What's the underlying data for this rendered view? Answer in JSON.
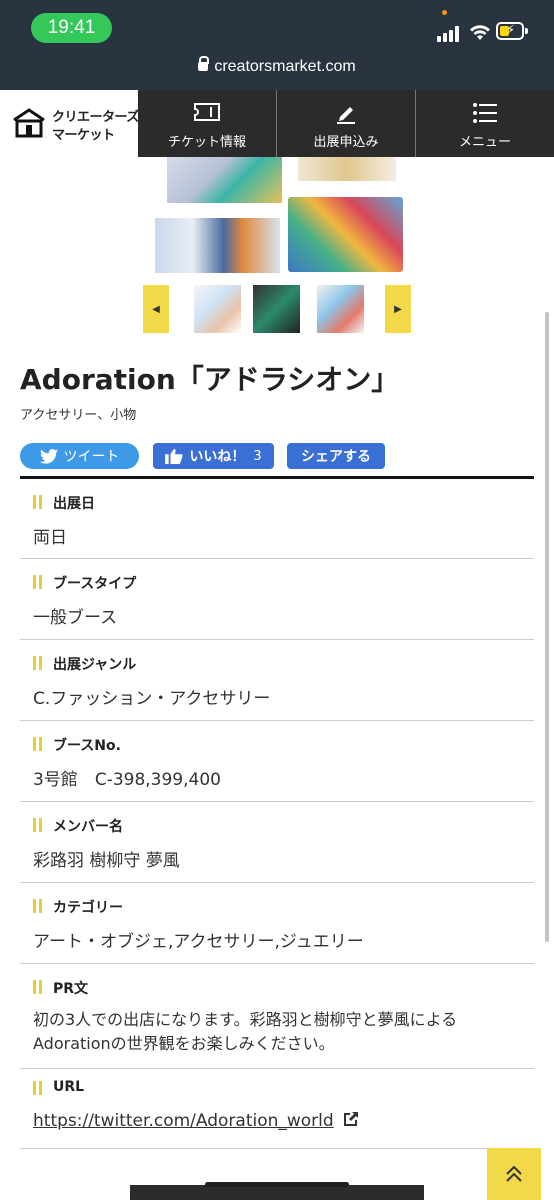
{
  "status": {
    "time": "19:41",
    "url": "creatorsmarket.com"
  },
  "logo": {
    "line1": "クリエーターズ",
    "line2": "マーケット"
  },
  "nav": [
    {
      "label": "チケット情報",
      "icon": "ticket-icon"
    },
    {
      "label": "出展申込み",
      "icon": "pencil-icon"
    },
    {
      "label": "メニュー",
      "icon": "menu-icon"
    }
  ],
  "booth": {
    "title": "Adoration「アドラシオン」",
    "subtitle": "アクセサリー、小物"
  },
  "share": {
    "tweet": "ツイート",
    "like": "いいね！",
    "like_count": "3",
    "share": "シェアする"
  },
  "info": [
    {
      "label": "出展日",
      "value": "両日"
    },
    {
      "label": "ブースタイプ",
      "value": "一般ブース"
    },
    {
      "label": "出展ジャンル",
      "value": "C.ファッション・アクセサリー"
    },
    {
      "label": "ブースNo.",
      "value": "3号館　C-398,399,400"
    },
    {
      "label": "メンバー名",
      "value": "彩路羽 樹柳守 夢風"
    },
    {
      "label": "カテゴリー",
      "value": "アート・オブジェ,アクセサリー,ジュエリー"
    },
    {
      "label": "PR文",
      "value_line1": "初の3人での出店になります。彩路羽と樹柳守と夢風による",
      "value_line2": "Adorationの世界観をお楽しみください。"
    },
    {
      "label": "URL",
      "value": "https://twitter.com/Adoration_world"
    }
  ],
  "colors": {
    "accent_yellow": "#f2d94a",
    "nav_dark": "#2b2b2b",
    "twitter_blue": "#3e9ae8",
    "fb_blue": "#3a6fd6"
  }
}
